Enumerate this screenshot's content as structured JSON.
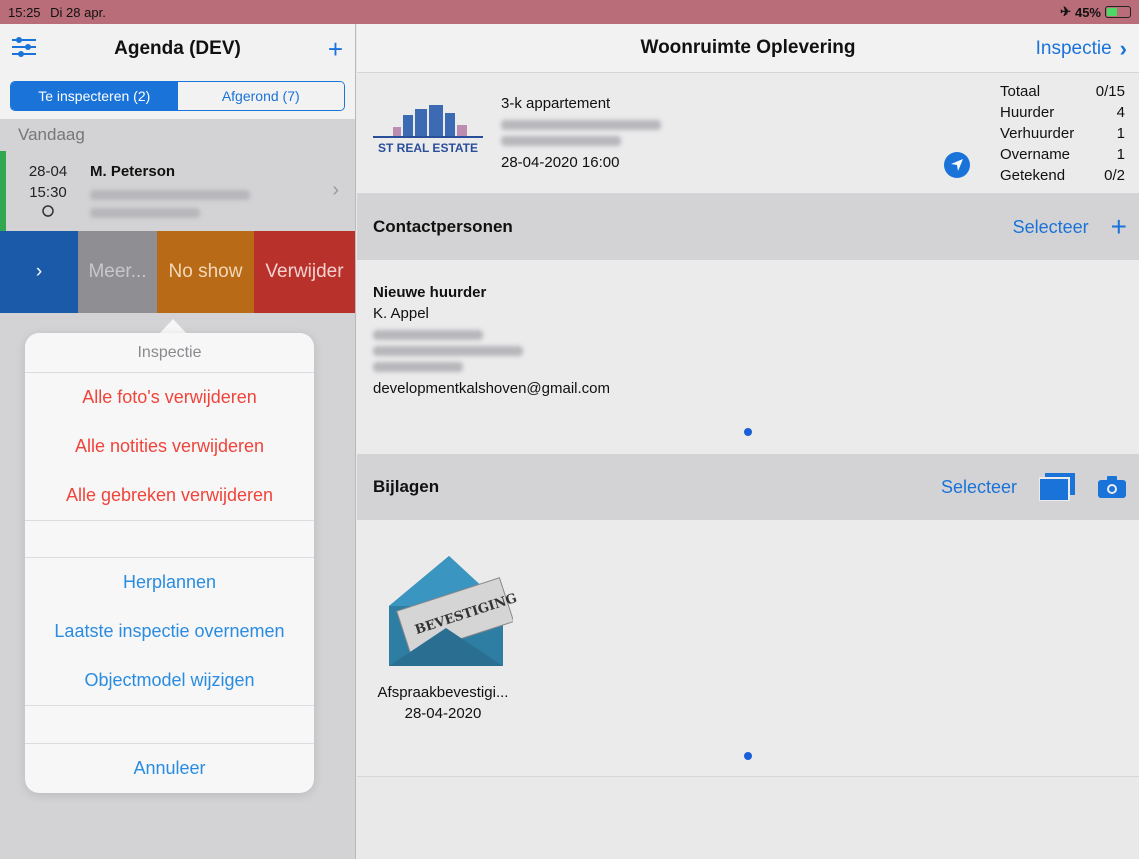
{
  "status_bar": {
    "time": "15:25",
    "date": "Di 28 apr.",
    "battery": "45%",
    "battery_level": 0.45,
    "airplane_glyph": "✈"
  },
  "left": {
    "title": "Agenda (DEV)",
    "segments": [
      "Te inspecteren (2)",
      "Afgerond (7)"
    ],
    "section": "Vandaag",
    "appointment": {
      "date": "28-04",
      "time": "15:30",
      "name": "M. Peterson"
    },
    "swipe_actions": {
      "open": "›",
      "more": "Meer...",
      "noshow": "No show",
      "delete": "Verwijder"
    }
  },
  "action_sheet": {
    "title": "Inspectie",
    "destructive": [
      "Alle foto's verwijderen",
      "Alle notities verwijderen",
      "Alle gebreken verwijderen"
    ],
    "actions": [
      "Herplannen",
      "Laatste inspectie overnemen",
      "Objectmodel wijzigen"
    ],
    "cancel": "Annuleer"
  },
  "right": {
    "title": "Woonruimte Oplevering",
    "nav_link": "Inspectie",
    "card": {
      "logo_text": "ST REAL ESTATE",
      "type": "3-k appartement",
      "datetime": "28-04-2020 16:00",
      "stats": [
        {
          "label": "Totaal",
          "value": "0/15"
        },
        {
          "label": "Huurder",
          "value": "4"
        },
        {
          "label": "Verhuurder",
          "value": "1"
        },
        {
          "label": "Overname",
          "value": "1"
        },
        {
          "label": "Getekend",
          "value": "0/2"
        }
      ]
    },
    "contacts": {
      "title": "Contactpersonen",
      "select": "Selecteer",
      "role": "Nieuwe huurder",
      "name": "K. Appel",
      "email": "developmentkalshoven@gmail.com"
    },
    "attachments": {
      "title": "Bijlagen",
      "select": "Selecteer",
      "item_image_text": "BEVESTIGING",
      "item_name": "Afspraakbevestigi...",
      "item_date": "28-04-2020"
    }
  },
  "colors": {
    "accent": "#1a73d9",
    "destructive": "#f0443a",
    "status_bar": "#b86d78"
  }
}
